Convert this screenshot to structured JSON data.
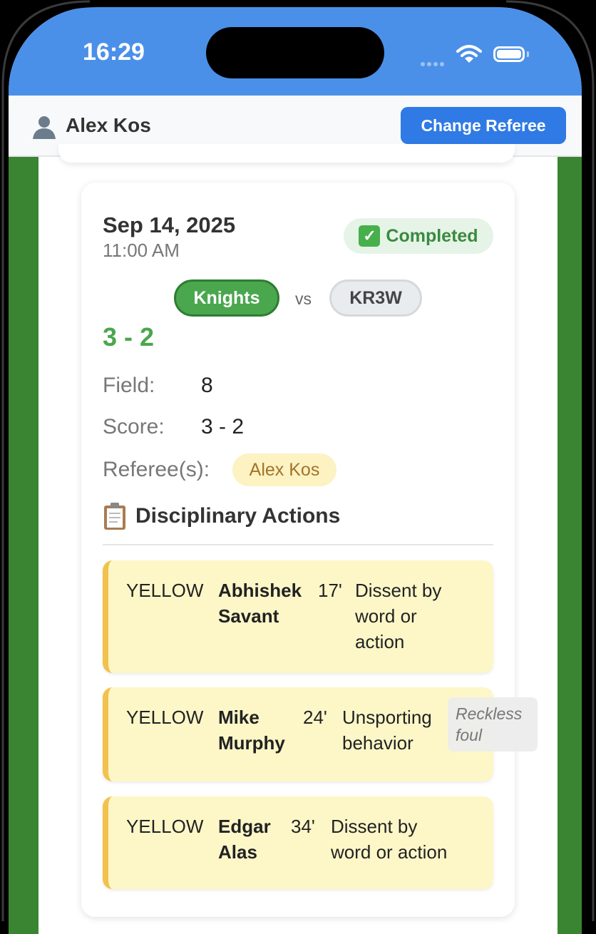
{
  "status_bar": {
    "time": "16:29"
  },
  "header": {
    "user_name": "Alex Kos",
    "change_button": "Change Referee"
  },
  "match": {
    "date": "Sep 14, 2025",
    "time": "11:00 AM",
    "status": "Completed",
    "home_team": "Knights",
    "vs": "vs",
    "away_team": "KR3W",
    "score_headline": "3 - 2",
    "field_label": "Field:",
    "field_value": "8",
    "score_label": "Score:",
    "score_value": "3 - 2",
    "referee_label": "Referee(s):",
    "referee": "Alex Kos"
  },
  "disciplinary": {
    "title": "Disciplinary Actions",
    "actions": [
      {
        "type": "YELLOW",
        "player_first": "Abhishek",
        "player_last": "Savant",
        "minute": "17'",
        "reason_lines": [
          "Dissent by",
          "word or",
          "action"
        ]
      },
      {
        "type": "YELLOW",
        "player_first": "Mike",
        "player_last": "Murphy",
        "minute": "24'",
        "reason_lines": [
          "Unsporting",
          "behavior"
        ]
      },
      {
        "type": "YELLOW",
        "player_first": "Edgar",
        "player_last": "Alas",
        "minute": "34'",
        "reason_lines": [
          "Dissent by",
          "word or action"
        ]
      }
    ],
    "overlay_note_lines": [
      "Reckless",
      "foul"
    ]
  },
  "colors": {
    "status_bar": "#4b90e8",
    "primary_button": "#2f7ae5",
    "home_team": "#4aa74e",
    "field_green": "#3a8532",
    "yellow_card_bg": "#fdf7c8",
    "yellow_card_accent": "#f2c24d"
  },
  "icons": {
    "user": "user-silhouette-icon",
    "status": "check-box-icon",
    "disciplinary": "clipboard-icon"
  }
}
